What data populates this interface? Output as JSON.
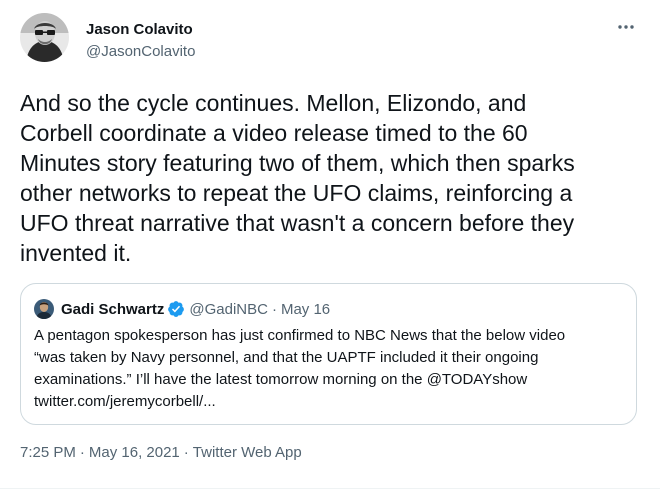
{
  "author": {
    "display_name": "Jason Colavito",
    "handle": "@JasonColavito"
  },
  "tweet": {
    "text_lines": [
      "And so the cycle continues. Mellon, Elizondo, and",
      "Corbell coordinate a video release timed to the 60",
      "Minutes story featuring two of them, which then sparks",
      "other networks to repeat the UFO claims, reinforcing a",
      "UFO threat narrative that wasn't a concern before they",
      "invented it."
    ]
  },
  "quoted_tweet": {
    "display_name": "Gadi Schwartz",
    "handle": "@GadiNBC",
    "separator": "·",
    "date": "May 16",
    "text_lines": [
      "A pentagon spokesperson has just confirmed to NBC News that the below video",
      "“was taken by Navy personnel, and that the UAPTF included it their ongoing",
      "examinations.” I’ll have the latest tomorrow morning on the @TODAYshow",
      "twitter.com/jeremycorbell/..."
    ]
  },
  "meta": {
    "time": "7:25 PM",
    "separator": "·",
    "date": "May 16, 2021",
    "source": "Twitter Web App"
  },
  "icons": {
    "more": "more-options-icon",
    "verified": "verified-badge-icon"
  },
  "colors": {
    "text_primary": "#0f1419",
    "text_secondary": "#536471",
    "verified_blue": "#1d9bf0",
    "border": "#cfd9de"
  }
}
